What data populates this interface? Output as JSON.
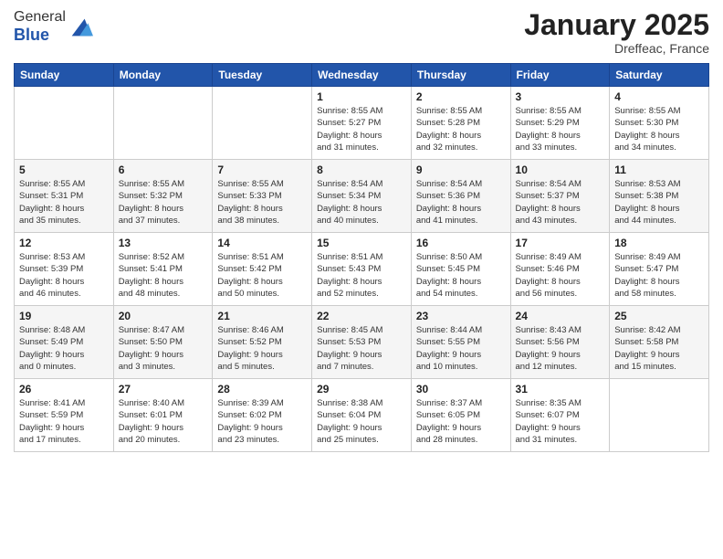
{
  "logo": {
    "line1": "General",
    "line2": "Blue"
  },
  "title": "January 2025",
  "location": "Dreffeac, France",
  "weekdays": [
    "Sunday",
    "Monday",
    "Tuesday",
    "Wednesday",
    "Thursday",
    "Friday",
    "Saturday"
  ],
  "weeks": [
    [
      {
        "day": "",
        "info": ""
      },
      {
        "day": "",
        "info": ""
      },
      {
        "day": "",
        "info": ""
      },
      {
        "day": "1",
        "info": "Sunrise: 8:55 AM\nSunset: 5:27 PM\nDaylight: 8 hours\nand 31 minutes."
      },
      {
        "day": "2",
        "info": "Sunrise: 8:55 AM\nSunset: 5:28 PM\nDaylight: 8 hours\nand 32 minutes."
      },
      {
        "day": "3",
        "info": "Sunrise: 8:55 AM\nSunset: 5:29 PM\nDaylight: 8 hours\nand 33 minutes."
      },
      {
        "day": "4",
        "info": "Sunrise: 8:55 AM\nSunset: 5:30 PM\nDaylight: 8 hours\nand 34 minutes."
      }
    ],
    [
      {
        "day": "5",
        "info": "Sunrise: 8:55 AM\nSunset: 5:31 PM\nDaylight: 8 hours\nand 35 minutes."
      },
      {
        "day": "6",
        "info": "Sunrise: 8:55 AM\nSunset: 5:32 PM\nDaylight: 8 hours\nand 37 minutes."
      },
      {
        "day": "7",
        "info": "Sunrise: 8:55 AM\nSunset: 5:33 PM\nDaylight: 8 hours\nand 38 minutes."
      },
      {
        "day": "8",
        "info": "Sunrise: 8:54 AM\nSunset: 5:34 PM\nDaylight: 8 hours\nand 40 minutes."
      },
      {
        "day": "9",
        "info": "Sunrise: 8:54 AM\nSunset: 5:36 PM\nDaylight: 8 hours\nand 41 minutes."
      },
      {
        "day": "10",
        "info": "Sunrise: 8:54 AM\nSunset: 5:37 PM\nDaylight: 8 hours\nand 43 minutes."
      },
      {
        "day": "11",
        "info": "Sunrise: 8:53 AM\nSunset: 5:38 PM\nDaylight: 8 hours\nand 44 minutes."
      }
    ],
    [
      {
        "day": "12",
        "info": "Sunrise: 8:53 AM\nSunset: 5:39 PM\nDaylight: 8 hours\nand 46 minutes."
      },
      {
        "day": "13",
        "info": "Sunrise: 8:52 AM\nSunset: 5:41 PM\nDaylight: 8 hours\nand 48 minutes."
      },
      {
        "day": "14",
        "info": "Sunrise: 8:51 AM\nSunset: 5:42 PM\nDaylight: 8 hours\nand 50 minutes."
      },
      {
        "day": "15",
        "info": "Sunrise: 8:51 AM\nSunset: 5:43 PM\nDaylight: 8 hours\nand 52 minutes."
      },
      {
        "day": "16",
        "info": "Sunrise: 8:50 AM\nSunset: 5:45 PM\nDaylight: 8 hours\nand 54 minutes."
      },
      {
        "day": "17",
        "info": "Sunrise: 8:49 AM\nSunset: 5:46 PM\nDaylight: 8 hours\nand 56 minutes."
      },
      {
        "day": "18",
        "info": "Sunrise: 8:49 AM\nSunset: 5:47 PM\nDaylight: 8 hours\nand 58 minutes."
      }
    ],
    [
      {
        "day": "19",
        "info": "Sunrise: 8:48 AM\nSunset: 5:49 PM\nDaylight: 9 hours\nand 0 minutes."
      },
      {
        "day": "20",
        "info": "Sunrise: 8:47 AM\nSunset: 5:50 PM\nDaylight: 9 hours\nand 3 minutes."
      },
      {
        "day": "21",
        "info": "Sunrise: 8:46 AM\nSunset: 5:52 PM\nDaylight: 9 hours\nand 5 minutes."
      },
      {
        "day": "22",
        "info": "Sunrise: 8:45 AM\nSunset: 5:53 PM\nDaylight: 9 hours\nand 7 minutes."
      },
      {
        "day": "23",
        "info": "Sunrise: 8:44 AM\nSunset: 5:55 PM\nDaylight: 9 hours\nand 10 minutes."
      },
      {
        "day": "24",
        "info": "Sunrise: 8:43 AM\nSunset: 5:56 PM\nDaylight: 9 hours\nand 12 minutes."
      },
      {
        "day": "25",
        "info": "Sunrise: 8:42 AM\nSunset: 5:58 PM\nDaylight: 9 hours\nand 15 minutes."
      }
    ],
    [
      {
        "day": "26",
        "info": "Sunrise: 8:41 AM\nSunset: 5:59 PM\nDaylight: 9 hours\nand 17 minutes."
      },
      {
        "day": "27",
        "info": "Sunrise: 8:40 AM\nSunset: 6:01 PM\nDaylight: 9 hours\nand 20 minutes."
      },
      {
        "day": "28",
        "info": "Sunrise: 8:39 AM\nSunset: 6:02 PM\nDaylight: 9 hours\nand 23 minutes."
      },
      {
        "day": "29",
        "info": "Sunrise: 8:38 AM\nSunset: 6:04 PM\nDaylight: 9 hours\nand 25 minutes."
      },
      {
        "day": "30",
        "info": "Sunrise: 8:37 AM\nSunset: 6:05 PM\nDaylight: 9 hours\nand 28 minutes."
      },
      {
        "day": "31",
        "info": "Sunrise: 8:35 AM\nSunset: 6:07 PM\nDaylight: 9 hours\nand 31 minutes."
      },
      {
        "day": "",
        "info": ""
      }
    ]
  ]
}
